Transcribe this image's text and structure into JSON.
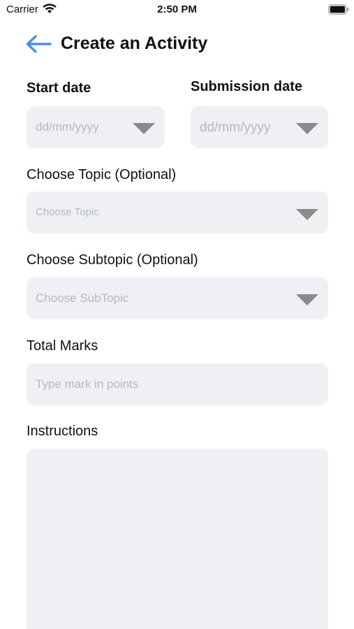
{
  "status_bar": {
    "carrier": "Carrier",
    "time": "2:50 PM"
  },
  "header": {
    "title": "Create an Activity",
    "back_icon": "arrow-left-icon"
  },
  "form": {
    "start_date": {
      "label": "Start date",
      "placeholder": "dd/mm/yyyy"
    },
    "submission_date": {
      "label": "Submission date",
      "placeholder": "dd/mm/yyyy"
    },
    "topic": {
      "label": "Choose Topic (Optional)",
      "placeholder": "Choose Topic"
    },
    "subtopic": {
      "label": "Choose Subtopic (Optional)",
      "placeholder": "Choose SubTopic"
    },
    "total_marks": {
      "label": "Total Marks",
      "placeholder": "Type mark in points",
      "value": ""
    },
    "instructions": {
      "label": "Instructions",
      "value": ""
    }
  },
  "colors": {
    "accent": "#4a90d9",
    "field_background": "#eef0f3",
    "placeholder": "#b5b9be",
    "caret": "#8a8a8a"
  }
}
